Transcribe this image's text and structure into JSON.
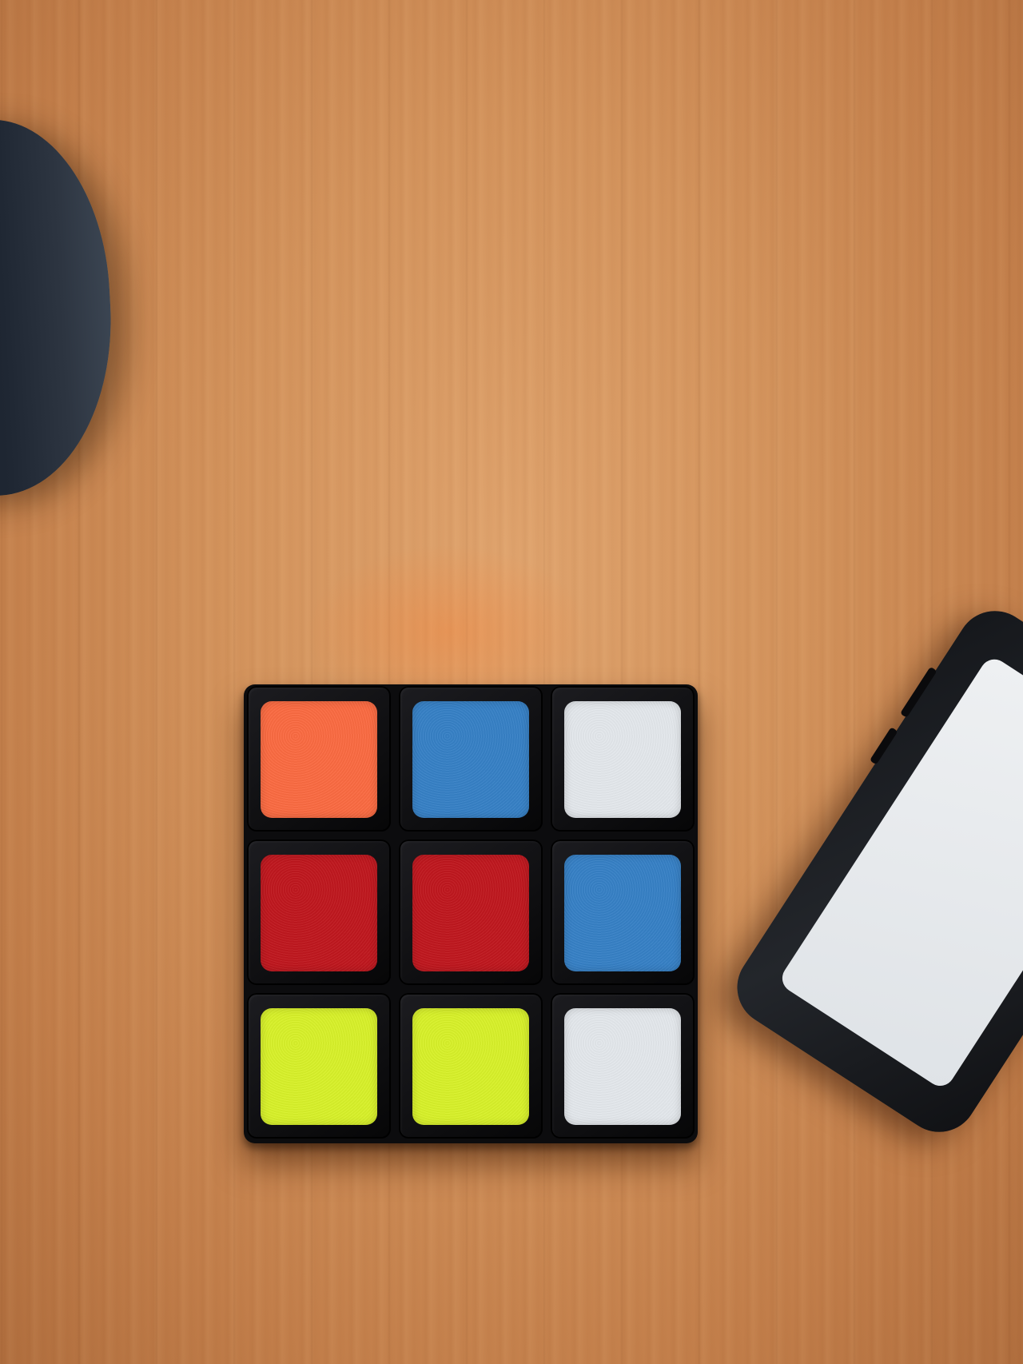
{
  "scene": {
    "description_hidden": false
  },
  "colors": {
    "table_wood": "#d3935c",
    "cube_body": "#0c0c0e",
    "orange": "#fb6b42",
    "blue": "#3781c6",
    "white": "#e4e8ec",
    "red": "#c0181f",
    "yellow_green": "#d8f12a"
  },
  "cube": {
    "face": [
      [
        "orange",
        "blue",
        "white"
      ],
      [
        "red",
        "red",
        "blue"
      ],
      [
        "yellow_green",
        "yellow_green",
        "white"
      ]
    ]
  }
}
